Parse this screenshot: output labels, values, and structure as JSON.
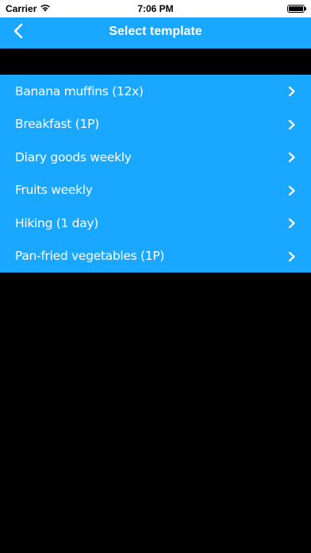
{
  "status_bar": {
    "carrier": "Carrier",
    "time": "7:06 PM"
  },
  "nav": {
    "title": "Select template",
    "back_icon": "chevron-left-icon"
  },
  "templates": [
    {
      "label": "Banana muffins (12x)"
    },
    {
      "label": "Breakfast (1P)"
    },
    {
      "label": "Diary goods weekly"
    },
    {
      "label": "Fruits weekly"
    },
    {
      "label": "Hiking (1 day)"
    },
    {
      "label": "Pan-fried vegetables (1P)"
    }
  ],
  "colors": {
    "accent": "#1aa7ff",
    "background": "#000000",
    "text": "#ffffff"
  }
}
